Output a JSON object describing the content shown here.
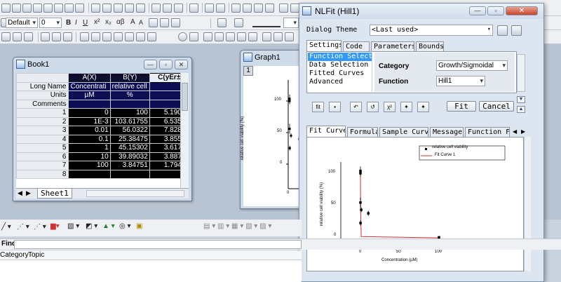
{
  "toolbar": {
    "font_name": "Default",
    "font_size": "0"
  },
  "book1": {
    "title": "Book1",
    "columns": [
      "A(X)",
      "B(Y)",
      "C(yEr±)"
    ],
    "header_rows": [
      {
        "label": "Long Name",
        "a": "Concentrati",
        "b": "relative cell",
        "c": ""
      },
      {
        "label": "Units",
        "a": "µM",
        "b": "%",
        "c": ""
      },
      {
        "label": "Comments",
        "a": "",
        "b": "",
        "c": ""
      }
    ],
    "rows": [
      {
        "n": "1",
        "a": "0",
        "b": "100",
        "c": "5.19056"
      },
      {
        "n": "2",
        "a": "1E-3",
        "b": "103.61755",
        "c": "6.53543"
      },
      {
        "n": "3",
        "a": "0.01",
        "b": "56.0322",
        "c": "7.82808"
      },
      {
        "n": "4",
        "a": "0.1",
        "b": "25.38475",
        "c": "3.85539"
      },
      {
        "n": "5",
        "a": "1",
        "b": "45.15302",
        "c": "3.61775"
      },
      {
        "n": "6",
        "a": "10",
        "b": "39.89032",
        "c": "3.88772"
      },
      {
        "n": "7",
        "a": "100",
        "b": "3.84751",
        "c": "1.79458"
      },
      {
        "n": "8",
        "a": "",
        "b": "",
        "c": ""
      }
    ],
    "sheet_tab": "Sheet1"
  },
  "graph1": {
    "title": "Graph1",
    "layer": "1",
    "ylabel": "relative cell viability (%)",
    "yticks": [
      "100",
      "50",
      "0"
    ],
    "xticks": [
      "0"
    ]
  },
  "nlfit": {
    "title": "NLFit (Hill1)",
    "dialog_theme_label": "Dialog Theme",
    "dialog_theme_value": "<Last used>",
    "tabs": [
      "Settings",
      "Code",
      "Parameters",
      "Bounds"
    ],
    "tree_items": [
      "Function Selection",
      "Data Selection",
      "Fitted Curves",
      "Advanced"
    ],
    "category_label": "Category",
    "category_value": "Growth/Sigmoidal",
    "function_label": "Function",
    "function_value": "Hill1",
    "fit_button": "Fit",
    "cancel_button": "Cancel",
    "bottom_tabs": [
      "Fit Curve",
      "Formula",
      "Sample Curve",
      "Messages",
      "Function Fil"
    ],
    "preview": {
      "legend_data": "relative cell viability",
      "legend_fit": "Fit Curve 1",
      "ylabel": "relative cell viability (%)",
      "xlabel": "Concentration (µM)",
      "yticks": [
        "100",
        "50",
        "0"
      ],
      "xticks": [
        "0",
        "50",
        "100"
      ]
    }
  },
  "find": {
    "label": "Find:"
  },
  "helpbar": {
    "items": [
      "Category",
      "Topic"
    ]
  },
  "chart_data": {
    "type": "scatter",
    "xlabel": "Concentration (µM)",
    "ylabel": "relative cell viability (%)",
    "series": [
      {
        "name": "relative cell viability",
        "x": [
          0,
          0.001,
          0.01,
          0.1,
          1,
          10,
          100
        ],
        "y": [
          100,
          103.61755,
          56.0322,
          25.38475,
          45.15302,
          39.89032,
          3.84751
        ],
        "err": [
          5.19056,
          6.53543,
          7.82808,
          3.85539,
          3.61775,
          3.88772,
          1.79458
        ]
      },
      {
        "name": "Fit Curve 1",
        "x": [
          0,
          0.3,
          1,
          100
        ],
        "y": [
          100,
          40,
          5,
          3
        ]
      }
    ],
    "xlim": [
      0,
      100
    ],
    "ylim": [
      0,
      110
    ],
    "legend": "top-right"
  }
}
